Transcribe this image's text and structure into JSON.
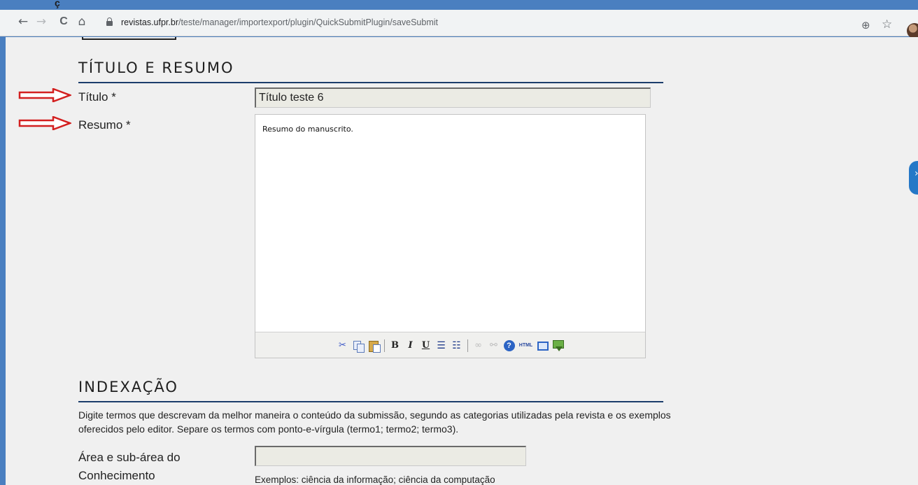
{
  "top_strip": {
    "glyph": "ç"
  },
  "browser": {
    "back_icon": "arrow-left-icon",
    "forward_icon": "arrow-right-icon",
    "reload_icon": "reload-icon",
    "home_icon": "home-icon",
    "url_host": "revistas.ufpr.br",
    "url_path": "/teste/manager/importexport/plugin/QuickSubmitPlugin/saveSubmit",
    "glyphs": {
      "back": "←",
      "forward": "→",
      "reload": "C",
      "home": "⌂",
      "zoom": "⊕",
      "star": "☆"
    }
  },
  "sections": {
    "title_abstract": {
      "heading": "TÍTULO E RESUMO",
      "title_label": "Título *",
      "title_value": "Título teste 6",
      "abstract_label": "Resumo *",
      "abstract_text": "Resumo do manuscrito."
    },
    "indexing": {
      "heading": "INDEXAÇÃO",
      "description": "Digite termos que descrevam da melhor maneira o conteúdo da submissão, segundo as categorias utilizadas pela revista e os exemplos oferecidos pelo editor. Separe os termos com ponto-e-vírgula (termo1; termo2; termo3).",
      "area_label": "Área e sub-área do Conhecimento",
      "area_value": "",
      "area_hint": "Exemplos: ciência da informação; ciência da computação"
    }
  },
  "editor_toolbar": {
    "buttons": [
      "cut",
      "copy",
      "paste",
      "bold",
      "italic",
      "underline",
      "bullet-list",
      "numbered-list",
      "link",
      "unlink",
      "help",
      "html",
      "fullscreen",
      "insert-image"
    ],
    "glyphs": {
      "cut": "✂",
      "bold": "B",
      "italic": "I",
      "underline": "U",
      "bullet_list": "☰",
      "numbered_list": "☷",
      "link": "∞",
      "unlink": "⚯",
      "help": "?",
      "html": "HTML"
    }
  },
  "annotation_color": "#d32020",
  "accent": "#1c3d6b",
  "side_tab_glyph": "›"
}
